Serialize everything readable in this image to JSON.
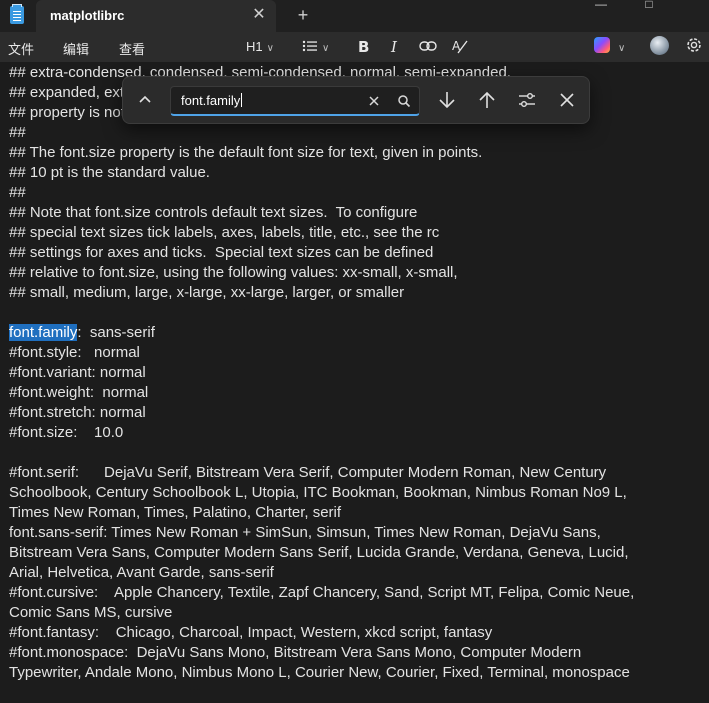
{
  "window": {
    "tab_title": "matplotlibrc",
    "close_tab": "✕",
    "new_tab": "+",
    "minimize": "—",
    "maximize": "□"
  },
  "menu": {
    "file": "文件",
    "edit": "编辑",
    "view": "查看"
  },
  "toolbar": {
    "heading": "H1",
    "bold": "B",
    "italic": "I"
  },
  "find": {
    "query": "font.family"
  },
  "editor": {
    "lines": [
      "## extra-condensed, condensed, semi-condensed, normal, semi-expanded,",
      "## expanded, extra-expanded or ultra-expanded. Only normal font-stretch",
      "## property is not currently implemented.",
      "##",
      "## The font.size property is the default font size for text, given in points.",
      "## 10 pt is the standard value.",
      "##",
      "## Note that font.size controls default text sizes.  To configure",
      "## special text sizes tick labels, axes, labels, title, etc., see the rc",
      "## settings for axes and ticks.  Special text sizes can be defined",
      "## relative to font.size, using the following values: xx-small, x-small,",
      "## small, medium, large, x-large, xx-large, larger, or smaller",
      "",
      "",
      "#font.style:   normal",
      "#font.variant: normal",
      "#font.weight:  normal",
      "#font.stretch: normal",
      "#font.size:    10.0",
      "",
      "#font.serif:      DejaVu Serif, Bitstream Vera Serif, Computer Modern Roman, New Century",
      "Schoolbook, Century Schoolbook L, Utopia, ITC Bookman, Bookman, Nimbus Roman No9 L,",
      "Times New Roman, Times, Palatino, Charter, serif",
      "font.sans-serif: Times New Roman + SimSun, Simsun, Times New Roman, DejaVu Sans,",
      "Bitstream Vera Sans, Computer Modern Sans Serif, Lucida Grande, Verdana, Geneva, Lucid,",
      "Arial, Helvetica, Avant Garde, sans-serif",
      "#font.cursive:    Apple Chancery, Textile, Zapf Chancery, Sand, Script MT, Felipa, Comic Neue,",
      "Comic Sans MS, cursive",
      "#font.fantasy:    Chicago, Charcoal, Impact, Western, xkcd script, fantasy",
      "#font.monospace:  DejaVu Sans Mono, Bitstream Vera Sans Mono, Computer Modern",
      "Typewriter, Andale Mono, Nimbus Mono L, Courier New, Courier, Fixed, Terminal, monospace"
    ],
    "match_line": {
      "match": "font.family",
      "rest": ":  sans-serif"
    }
  }
}
